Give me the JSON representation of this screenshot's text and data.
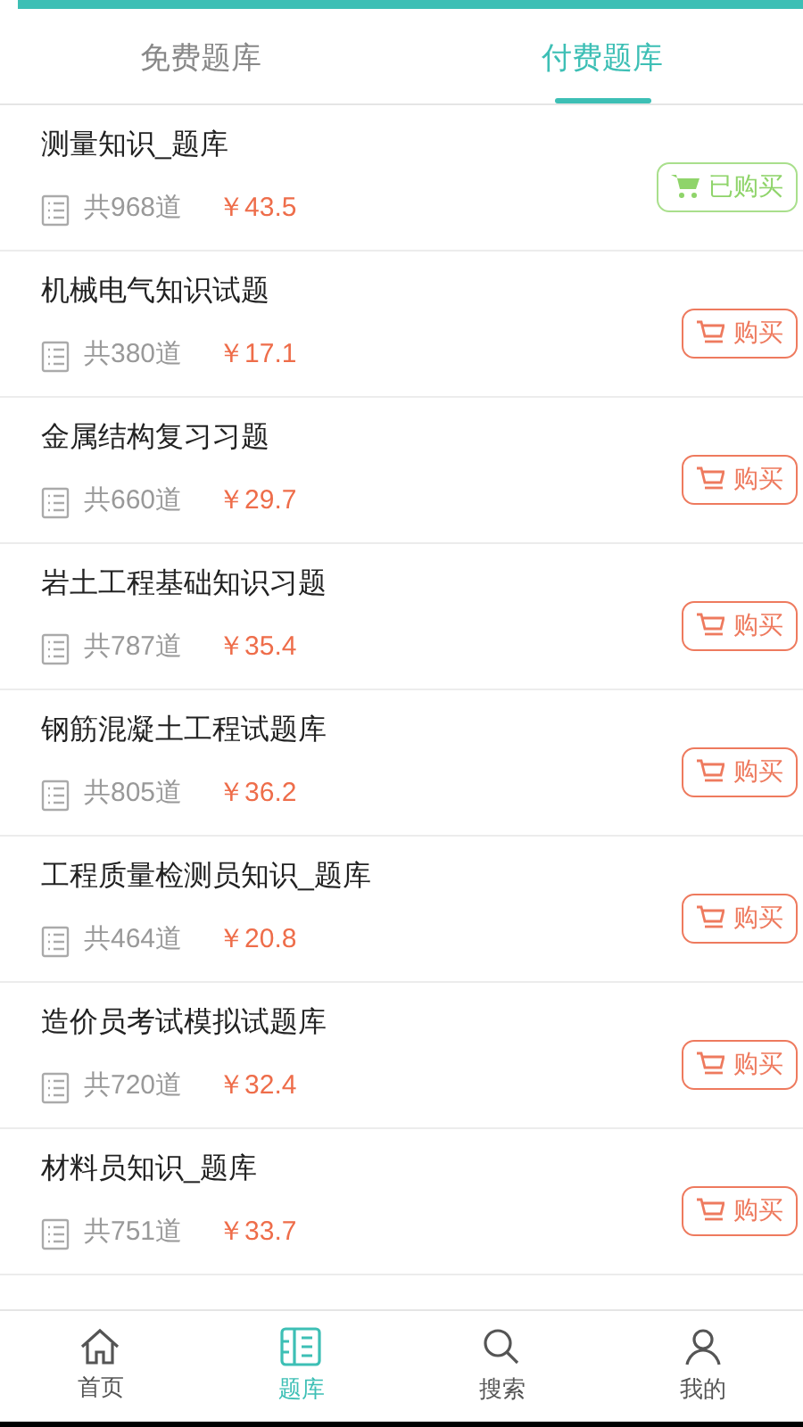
{
  "tabs": [
    {
      "label": "免费题库",
      "selected": false
    },
    {
      "label": "付费题库",
      "selected": true
    }
  ],
  "banks": [
    {
      "title": "测量知识_题库",
      "count": "共968道",
      "price": "￥43.5",
      "purchased": true,
      "button": "已购买"
    },
    {
      "title": "机械电气知识试题",
      "count": "共380道",
      "price": "￥17.1",
      "purchased": false,
      "button": "购买"
    },
    {
      "title": "金属结构复习习题",
      "count": "共660道",
      "price": "￥29.7",
      "purchased": false,
      "button": "购买"
    },
    {
      "title": "岩土工程基础知识习题",
      "count": "共787道",
      "price": "￥35.4",
      "purchased": false,
      "button": "购买"
    },
    {
      "title": "钢筋混凝土工程试题库",
      "count": "共805道",
      "price": "￥36.2",
      "purchased": false,
      "button": "购买"
    },
    {
      "title": "工程质量检测员知识_题库",
      "count": "共464道",
      "price": "￥20.8",
      "purchased": false,
      "button": "购买"
    },
    {
      "title": "造价员考试模拟试题库",
      "count": "共720道",
      "price": "￥32.4",
      "purchased": false,
      "button": "购买"
    },
    {
      "title": "材料员知识_题库",
      "count": "共751道",
      "price": "￥33.7",
      "purchased": false,
      "button": "购买"
    }
  ],
  "nav": [
    {
      "label": "首页",
      "kind": "home",
      "selected": false
    },
    {
      "label": "题库",
      "kind": "bank",
      "selected": true
    },
    {
      "label": "搜索",
      "kind": "search",
      "selected": false
    },
    {
      "label": "我的",
      "kind": "profile",
      "selected": false
    }
  ]
}
